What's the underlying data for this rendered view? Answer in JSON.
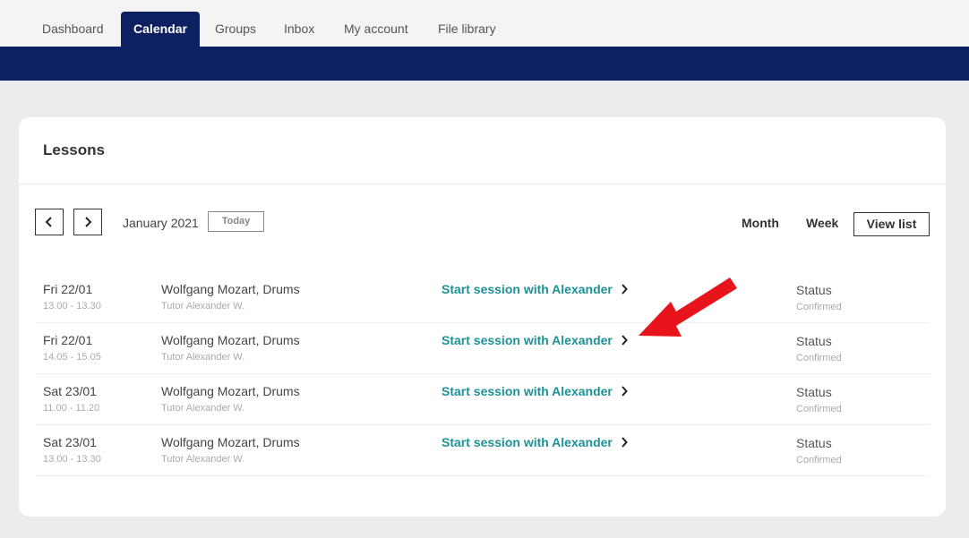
{
  "nav": {
    "tabs": [
      {
        "label": "Dashboard",
        "active": false
      },
      {
        "label": "Calendar",
        "active": true
      },
      {
        "label": "Groups",
        "active": false
      },
      {
        "label": "Inbox",
        "active": false
      },
      {
        "label": "My account",
        "active": false
      },
      {
        "label": "File library",
        "active": false
      }
    ]
  },
  "colors": {
    "brand": "#0d2162",
    "accent": "#1d9196",
    "annotation": "#e8141b"
  },
  "lessons": {
    "title": "Lessons",
    "month": "January 2021",
    "today_label": "Today",
    "views": {
      "month": "Month",
      "week": "Week",
      "list": "View list"
    },
    "rows": [
      {
        "date": "Fri 22/01",
        "time": "13.00 - 13.30",
        "student": "Wolfgang Mozart, Drums",
        "tutor": "Tutor Alexander W.",
        "action": "Start session with Alexander",
        "status_label": "Status",
        "status": "Confirmed"
      },
      {
        "date": "Fri 22/01",
        "time": "14.05 - 15.05",
        "student": "Wolfgang Mozart, Drums",
        "tutor": "Tutor Alexander W.",
        "action": "Start session with Alexander",
        "status_label": "Status",
        "status": "Confirmed"
      },
      {
        "date": "Sat 23/01",
        "time": "11.00 - 11.20",
        "student": "Wolfgang Mozart, Drums",
        "tutor": "Tutor Alexander W.",
        "action": "Start session with Alexander",
        "status_label": "Status",
        "status": "Confirmed"
      },
      {
        "date": "Sat 23/01",
        "time": "13.00 - 13.30",
        "student": "Wolfgang Mozart, Drums",
        "tutor": "Tutor Alexander W.",
        "action": "Start session with Alexander",
        "status_label": "Status",
        "status": "Confirmed"
      }
    ]
  }
}
